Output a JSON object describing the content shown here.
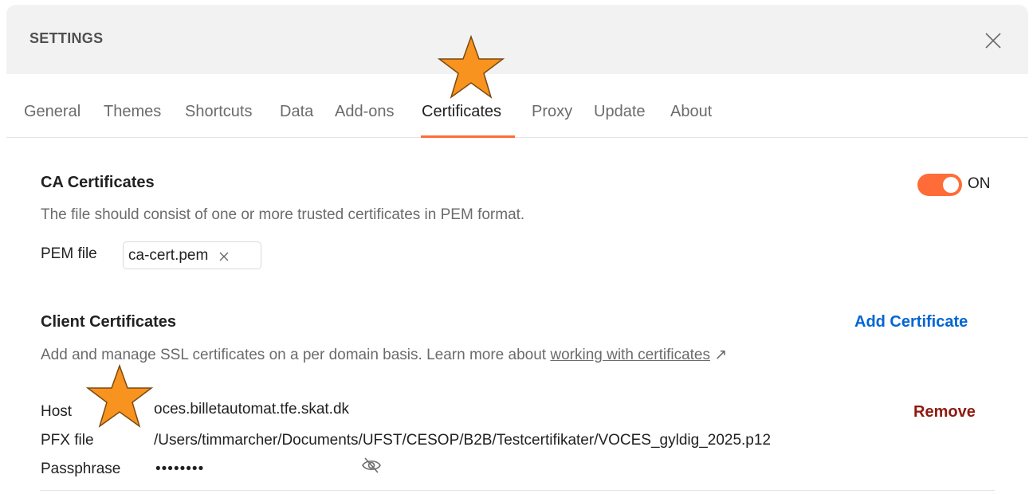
{
  "header": {
    "title": "SETTINGS"
  },
  "tabs": [
    {
      "label": "General"
    },
    {
      "label": "Themes"
    },
    {
      "label": "Shortcuts"
    },
    {
      "label": "Data"
    },
    {
      "label": "Add-ons"
    },
    {
      "label": "Certificates"
    },
    {
      "label": "Proxy"
    },
    {
      "label": "Update"
    },
    {
      "label": "About"
    }
  ],
  "active_tab": "Certificates",
  "ca_certificates": {
    "title": "CA Certificates",
    "toggle_label": "ON",
    "toggle_on": true,
    "description": "The file should consist of one or more trusted certificates in PEM format.",
    "pem_label": "PEM file",
    "pem_value": "ca-cert.pem"
  },
  "client_certificates": {
    "title": "Client Certificates",
    "add_label": "Add Certificate",
    "description_prefix": "Add and manage SSL certificates on a per domain basis. Learn more about ",
    "description_link": "working with certificates",
    "description_suffix": " ↗",
    "entries": [
      {
        "host_label": "Host",
        "host_value": "oces.billetautomat.tfe.skat.dk",
        "pfx_label": "PFX file",
        "pfx_value": "/Users/timmarcher/Documents/UFST/CESOP/B2B/Testcertifikater/VOCES_gyldig_2025.p12",
        "passphrase_label": "Passphrase",
        "passphrase_value": "••••••••",
        "remove_label": "Remove"
      }
    ]
  },
  "colors": {
    "accent": "#ff6c37",
    "link": "#0265d2",
    "danger": "#8e1a10",
    "star": "#f7931e"
  },
  "icons": {
    "close": "close-icon",
    "chip_remove": "close-icon",
    "eye": "eye-off-icon",
    "external": "arrow-up-right-icon",
    "annotation": "star-icon"
  }
}
